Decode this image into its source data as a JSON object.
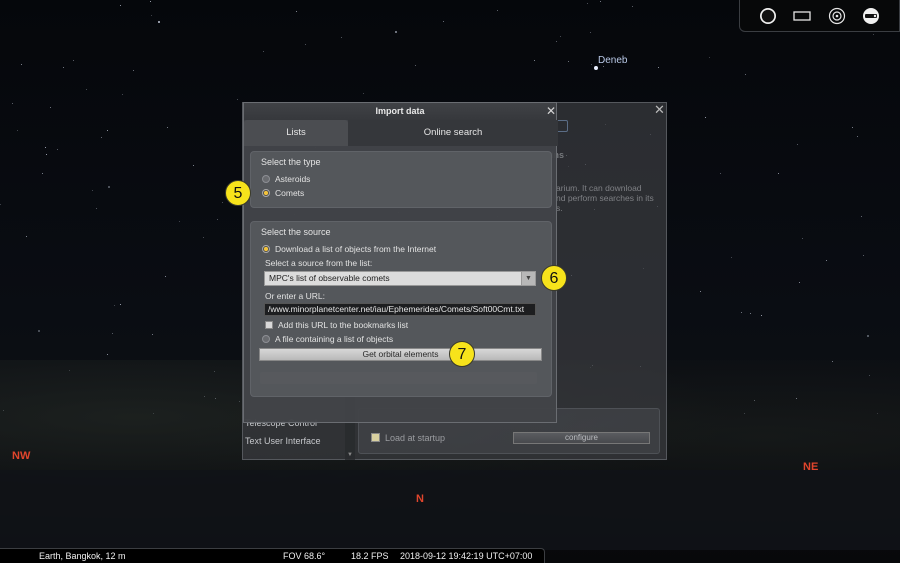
{
  "sky": {
    "star_label": "Deneb",
    "cardinals": {
      "nw": "NW",
      "n": "N",
      "ne": "NE"
    }
  },
  "toolbar": {
    "icons": [
      "night-mode-icon",
      "fullscreen-icon",
      "target-icon",
      "telescope-icon"
    ]
  },
  "background_window": {
    "faint_tab": "ins",
    "faint_text_1": "arium. It can download",
    "faint_text_2": "nd perform searches in its",
    "faint_text_3": "s.",
    "left_items": [
      "Telescope Control",
      "Text User Interface"
    ],
    "load_at_startup": "Load at startup",
    "configure_label": "configure"
  },
  "dialog": {
    "title": "Import data",
    "tabs": [
      {
        "label": "Lists",
        "active": true
      },
      {
        "label": "Online search",
        "active": false
      }
    ],
    "type_group": {
      "title": "Select the type",
      "options": [
        {
          "label": "Asteroids",
          "selected": false
        },
        {
          "label": "Comets",
          "selected": true
        }
      ]
    },
    "source_group": {
      "title": "Select the source",
      "download_option": "Download a list of objects from the Internet",
      "select_label": "Select a source from the list:",
      "selected_source": "MPC's list of observable comets",
      "url_label": "Or enter a URL:",
      "url_value": "/www.minorplanetcenter.net/iau/Ephemerides/Comets/Soft00Cmt.txt",
      "bookmark_label": "Add this URL to the bookmarks list",
      "file_option": "A file containing a list of objects",
      "get_button": "Get orbital elements"
    }
  },
  "badges": {
    "b5": "5",
    "b6": "6",
    "b7": "7"
  },
  "status_bar": {
    "location": "Earth, Bangkok, 12 m",
    "fov": "FOV 68.6°",
    "fps": "18.2 FPS",
    "datetime": "2018-09-12 19:42:19 UTC+07:00"
  },
  "colors": {
    "accent_badge": "#f7e31b",
    "cardinal": "#e0452c",
    "radio_selected": "#f2c23c"
  }
}
